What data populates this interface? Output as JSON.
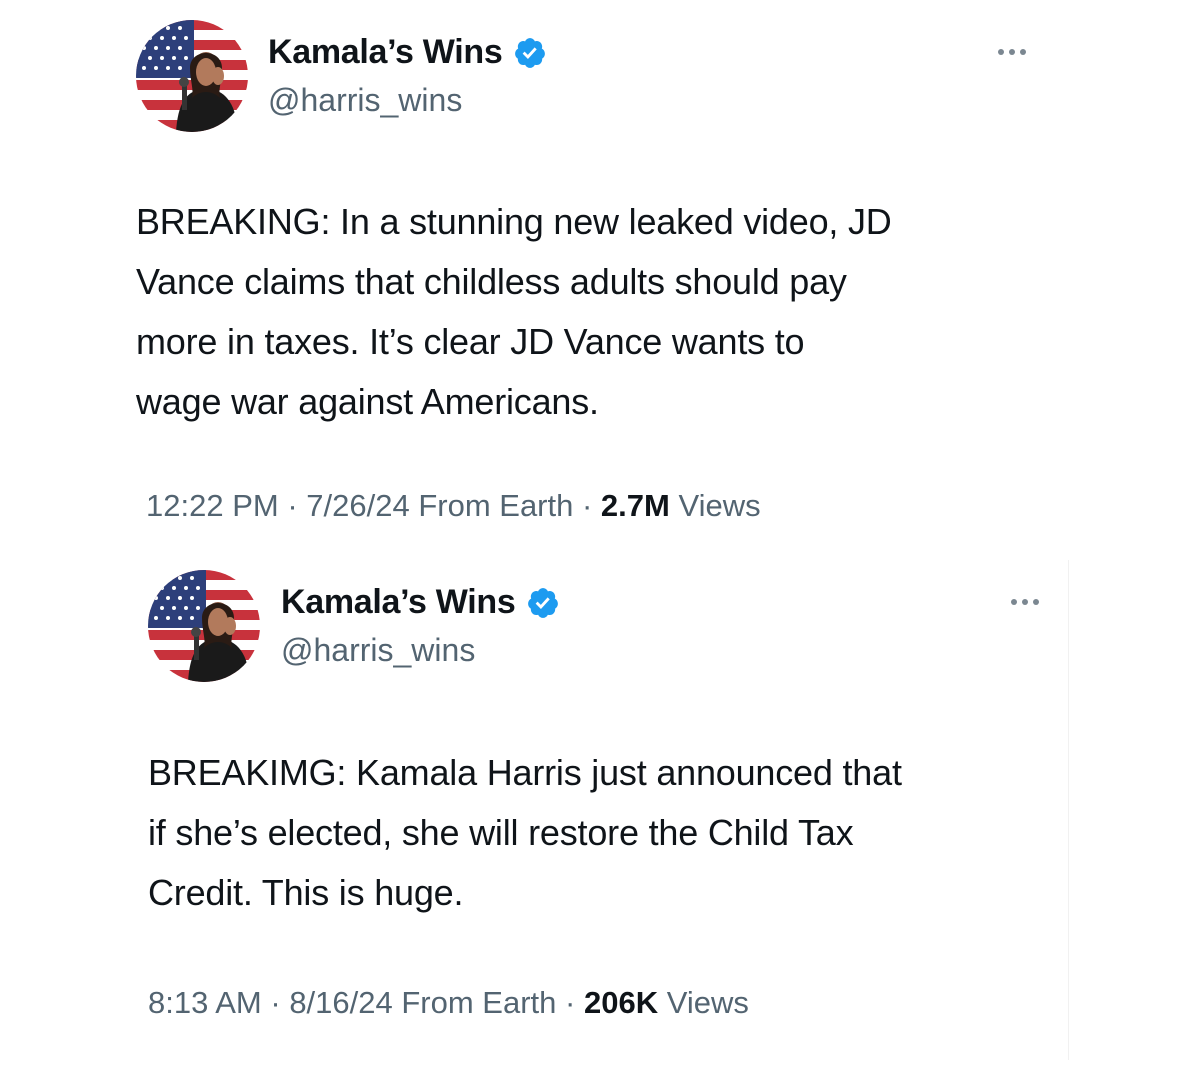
{
  "tweets": [
    {
      "display_name": "Kamala’s Wins",
      "handle": "@harris_wins",
      "verified_icon": "verified-badge-icon",
      "text": "BREAKING: In a stunning new leaked video, JD\nVance claims that childless adults should pay\nmore in taxes. It’s clear JD Vance wants to\nwage war against Americans.",
      "time": "12:22 PM",
      "date": "7/26/24",
      "source": "From Earth",
      "views_count": "2.7M",
      "views_label": "Views"
    },
    {
      "display_name": "Kamala’s Wins",
      "handle": "@harris_wins",
      "verified_icon": "verified-badge-icon",
      "text": "BREAKIMG: Kamala Harris just announced that\nif she’s elected, she will restore the Child Tax\nCredit. This is huge.",
      "time": "8:13 AM",
      "date": "8/16/24",
      "source": "From Earth",
      "views_count": "206K",
      "views_label": "Views"
    }
  ],
  "separator": " · ",
  "colors": {
    "verified_blue": "#1d9bf0",
    "secondary_text": "#536471",
    "primary_text": "#0f1419"
  }
}
